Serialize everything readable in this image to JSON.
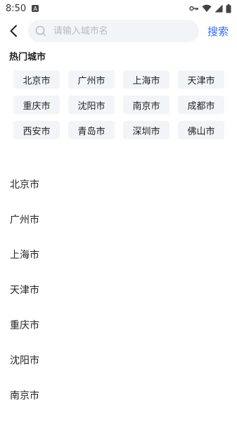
{
  "status_bar": {
    "time": "8:50",
    "notification_icon": "a-box-icon",
    "right_icons": [
      "key-icon",
      "wifi-icon",
      "signal-icon",
      "battery-icon"
    ]
  },
  "header": {
    "back_icon": "back-arrow-icon",
    "search_placeholder": "请输入城市名",
    "search_value": "",
    "search_button_label": "搜索",
    "accent_color": "#2f6bff"
  },
  "hot": {
    "title": "热门城市",
    "cities": [
      "北京市",
      "广州市",
      "上海市",
      "天津市",
      "重庆市",
      "沈阳市",
      "南京市",
      "成都市",
      "西安市",
      "青岛市",
      "深圳市",
      "佛山市"
    ]
  },
  "list": {
    "cities": [
      "北京市",
      "广州市",
      "上海市",
      "天津市",
      "重庆市",
      "沈阳市",
      "南京市"
    ]
  }
}
